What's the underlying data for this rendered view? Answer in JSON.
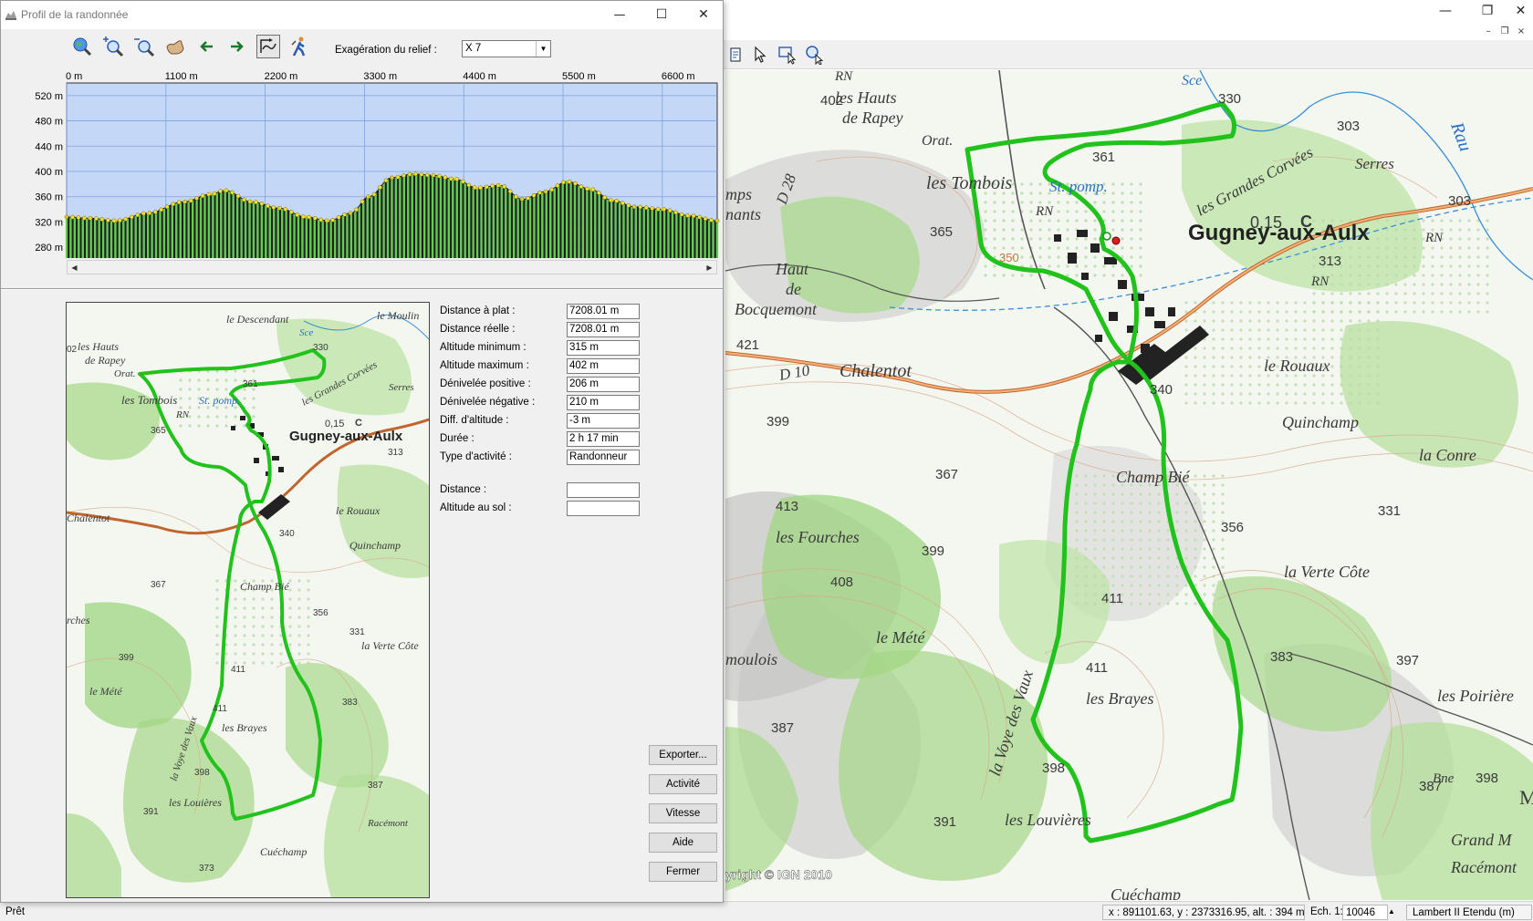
{
  "dialog": {
    "title": "Profil de la randonnée",
    "exaggeration_label": "Exagération du relief :",
    "exaggeration_value": "X 7",
    "icons": [
      "zoom-globe-icon",
      "zoom-in-icon",
      "zoom-out-icon",
      "pan-hand-icon",
      "arrow-left-icon",
      "arrow-right-icon",
      "route-view-icon",
      "hiker-icon"
    ]
  },
  "profile_chart": {
    "x_ticks": [
      "0 m",
      "1100 m",
      "2200 m",
      "3300 m",
      "4400 m",
      "5500 m",
      "6600 m"
    ],
    "y_ticks": [
      "520 m",
      "480 m",
      "440 m",
      "400 m",
      "360 m",
      "320 m",
      "280 m"
    ]
  },
  "chart_data": {
    "type": "area",
    "xlabel": "",
    "ylabel": "",
    "x_unit": "m",
    "y_unit": "m",
    "xlim": [
      0,
      7208
    ],
    "ylim": [
      260,
      540
    ],
    "grid": true,
    "series": [
      {
        "x": [
          0,
          250,
          550,
          900,
          1300,
          1600,
          1750,
          2050,
          2350,
          2650,
          2900,
          3150,
          3350,
          3600,
          3850,
          4050,
          4300,
          4550,
          4800,
          5050,
          5300,
          5550,
          5800,
          6050,
          6300,
          6600,
          6900,
          7208
        ],
        "y": [
          328,
          326,
          322,
          334,
          352,
          364,
          370,
          352,
          342,
          328,
          322,
          334,
          360,
          390,
          396,
          394,
          388,
          374,
          378,
          356,
          368,
          384,
          372,
          354,
          344,
          340,
          330,
          322
        ]
      }
    ]
  },
  "stats": [
    {
      "label": "Distance à plat :",
      "value": "7208.01 m"
    },
    {
      "label": "Distance réelle :",
      "value": "7208.01 m"
    },
    {
      "label": "Altitude minimum :",
      "value": "315 m"
    },
    {
      "label": "Altitude maximum :",
      "value": "402 m"
    },
    {
      "label": "Dénivelée positive :",
      "value": "206 m"
    },
    {
      "label": "Dénivelée négative :",
      "value": "210 m"
    },
    {
      "label": "Diff. d'altitude :",
      "value": "-3 m"
    },
    {
      "label": "Durée :",
      "value": "2 h 17 min"
    },
    {
      "label": "Type d'activité :",
      "value": "Randonneur"
    }
  ],
  "cursor_fields": [
    {
      "label": "Distance :",
      "value": ""
    },
    {
      "label": "Altitude au sol :",
      "value": ""
    }
  ],
  "buttons": {
    "export": "Exporter...",
    "activity": "Activité",
    "speed": "Vitesse",
    "help": "Aide",
    "close": "Fermer"
  },
  "main_map": {
    "labels": [
      "les Hauts",
      "de Rapey",
      "Orat.",
      "les Tombois",
      "St. pomp.",
      "les Grandes Corvées",
      "Serres",
      "Gugney-aux-Aulx",
      "Haut",
      "de",
      "Bocquemont",
      "Chalentot",
      "le Rouaux",
      "Quinchamp",
      "la Conre",
      "Champ Bié",
      "les Fourches",
      "la Verte Côte",
      "le Mété",
      "la Voye des Vaux",
      "les Brayes",
      "les Poirière",
      "les Louvières",
      "Grand M",
      "Racémont",
      "Cuéchamp",
      "Rau",
      "mps",
      "nants",
      "moulois",
      "Bne",
      "RN",
      "D 28",
      "D 10",
      "M",
      "Sce"
    ],
    "numbers": [
      "402",
      "330",
      "303",
      "361",
      "365",
      "350",
      "303",
      "313",
      "421",
      "399",
      "367",
      "413",
      "356",
      "331",
      "399",
      "408",
      "411",
      "383",
      "397",
      "398",
      "411",
      "387",
      "398",
      "387",
      "391",
      "340",
      "0,15",
      "C"
    ],
    "copyright": "yright © IGN 2010"
  },
  "mini_map": {
    "labels": [
      "le Descendant",
      "le Moulin",
      "les Hauts",
      "de Rapey",
      "Orat.",
      "les Tombois",
      "St. pomp.",
      "les Grandes Corvées",
      "Serres",
      "Gugney-aux-Aulx",
      "Chalentot",
      "le Rouaux",
      "Quinchamp",
      "Champ Bié",
      "la Verte Côte",
      "le Mété",
      "la Voye des Vaux",
      "les Brayes",
      "les Louières",
      "Racémont",
      "Cuéchamp",
      "RN",
      "Sce",
      "rches"
    ],
    "numbers": [
      "02",
      "330",
      "361",
      "365",
      "0,15",
      "C",
      "313",
      "340",
      "367",
      "356",
      "331",
      "399",
      "411",
      "411",
      "383",
      "398",
      "387",
      "391",
      "373"
    ]
  },
  "status_bar": {
    "ready": "Prêt",
    "coordinates": "x : 891101.63, y : 2373316.95, alt. : 394 m",
    "scale_label": "Ech. 1:",
    "scale_value": "10046",
    "projection": "Lambert II Etendu (m)"
  }
}
